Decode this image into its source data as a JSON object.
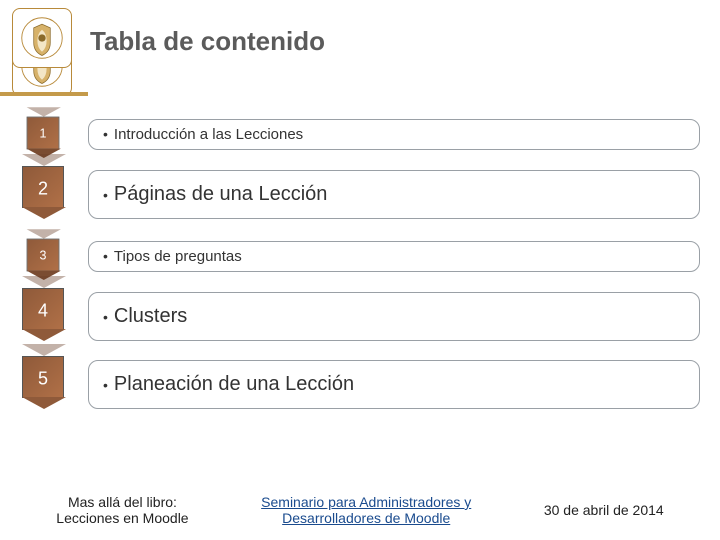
{
  "header": {
    "title": "Tabla de contenido"
  },
  "toc": [
    {
      "num": "1",
      "text": "Introducción a las Lecciones",
      "size": "small"
    },
    {
      "num": "2",
      "text": "Páginas de una Lección",
      "size": "large"
    },
    {
      "num": "3",
      "text": "Tipos de preguntas",
      "size": "small"
    },
    {
      "num": "4",
      "text": "Clusters",
      "size": "large"
    },
    {
      "num": "5",
      "text": "Planeación de una Lección",
      "size": "large"
    }
  ],
  "footer": {
    "left_line1": "Mas allá del libro:",
    "left_line2": "Lecciones en Moodle",
    "mid_line1": "Seminario para Administradores y",
    "mid_line2": "Desarrolladores de Moodle",
    "right": "30 de abril de 2014"
  },
  "colors": {
    "accent": "#c49a4a",
    "chevron_dark": "#8f5a3a",
    "chevron_light": "#b07047"
  }
}
